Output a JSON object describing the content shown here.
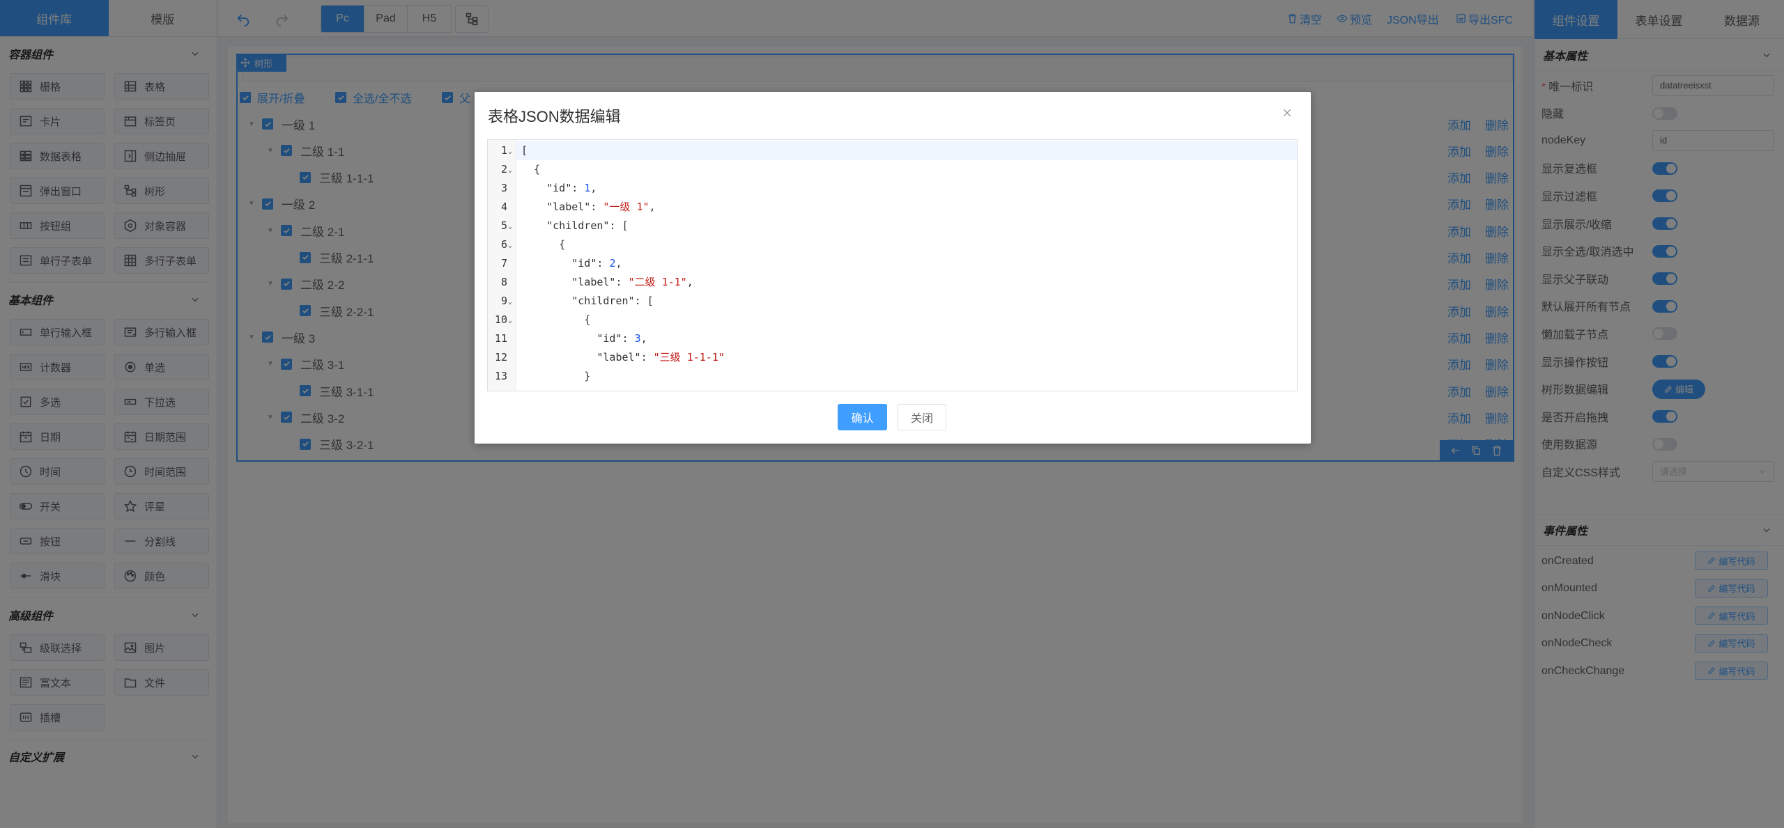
{
  "left": {
    "tabs": [
      "组件库",
      "模版"
    ],
    "sections": [
      {
        "title": "容器组件",
        "items": [
          {
            "label": "栅格",
            "icon": "grid-icon"
          },
          {
            "label": "表格",
            "icon": "table-icon"
          },
          {
            "label": "卡片",
            "icon": "card-icon"
          },
          {
            "label": "标签页",
            "icon": "tabs-icon"
          },
          {
            "label": "数据表格",
            "icon": "data-table-icon"
          },
          {
            "label": "侧边抽屉",
            "icon": "drawer-icon"
          },
          {
            "label": "弹出窗口",
            "icon": "dialog-icon"
          },
          {
            "label": "树形",
            "icon": "tree-icon"
          },
          {
            "label": "按钮组",
            "icon": "button-group-icon"
          },
          {
            "label": "对象容器",
            "icon": "object-container-icon"
          },
          {
            "label": "单行子表单",
            "icon": "sub-form-icon"
          },
          {
            "label": "多行子表单",
            "icon": "grid-sub-form-icon"
          }
        ]
      },
      {
        "title": "基本组件",
        "items": [
          {
            "label": "单行输入框",
            "icon": "input-icon"
          },
          {
            "label": "多行输入框",
            "icon": "textarea-icon"
          },
          {
            "label": "计数器",
            "icon": "number-icon"
          },
          {
            "label": "单选",
            "icon": "radio-icon"
          },
          {
            "label": "多选",
            "icon": "checkbox-icon"
          },
          {
            "label": "下拉选",
            "icon": "select-icon"
          },
          {
            "label": "日期",
            "icon": "date-icon"
          },
          {
            "label": "日期范围",
            "icon": "date-range-icon"
          },
          {
            "label": "时间",
            "icon": "time-icon"
          },
          {
            "label": "时间范围",
            "icon": "time-range-icon"
          },
          {
            "label": "开关",
            "icon": "switch-icon"
          },
          {
            "label": "评星",
            "icon": "star-icon"
          },
          {
            "label": "按钮",
            "icon": "button-icon"
          },
          {
            "label": "分割线",
            "icon": "divider-icon"
          },
          {
            "label": "滑块",
            "icon": "slider-icon"
          },
          {
            "label": "颜色",
            "icon": "palette-icon"
          }
        ]
      },
      {
        "title": "高级组件",
        "items": [
          {
            "label": "级联选择",
            "icon": "cascader-icon"
          },
          {
            "label": "图片",
            "icon": "picture-icon"
          },
          {
            "label": "富文本",
            "icon": "rich-text-icon"
          },
          {
            "label": "文件",
            "icon": "folder-icon"
          },
          {
            "label": "插槽",
            "icon": "slot-icon"
          }
        ]
      },
      {
        "title": "自定义扩展",
        "items": []
      }
    ]
  },
  "toolbar": {
    "devices": [
      "Pc",
      "Pad",
      "H5"
    ],
    "active_device": "Pc",
    "actions": [
      "清空",
      "预览",
      "JSON导出",
      "导出SFC"
    ]
  },
  "canvas": {
    "tree_tag": "树形",
    "options": [
      "展开/折叠",
      "全选/全不选",
      "父"
    ],
    "add_label": "添加",
    "delete_label": "删除",
    "nodes": [
      {
        "label": "一级 1",
        "level": 1,
        "expanded": true
      },
      {
        "label": "二级 1-1",
        "level": 2,
        "expanded": true
      },
      {
        "label": "三级 1-1-1",
        "level": 3
      },
      {
        "label": "一级 2",
        "level": 1,
        "expanded": true
      },
      {
        "label": "二级 2-1",
        "level": 2,
        "expanded": true
      },
      {
        "label": "三级 2-1-1",
        "level": 3
      },
      {
        "label": "二级 2-2",
        "level": 2,
        "expanded": true
      },
      {
        "label": "三级 2-2-1",
        "level": 3
      },
      {
        "label": "一级 3",
        "level": 1,
        "expanded": true
      },
      {
        "label": "二级 3-1",
        "level": 2,
        "expanded": true
      },
      {
        "label": "三级 3-1-1",
        "level": 3
      },
      {
        "label": "二级 3-2",
        "level": 2,
        "expanded": true
      },
      {
        "label": "三级 3-2-1",
        "level": 3
      }
    ]
  },
  "right": {
    "tabs": [
      "组件设置",
      "表单设置",
      "数据源"
    ],
    "basic_title": "基本属性",
    "props": [
      {
        "label": "唯一标识",
        "type": "input",
        "value": "datatreeisxst",
        "required": true
      },
      {
        "label": "隐藏",
        "type": "switch",
        "on": false
      },
      {
        "label": "nodeKey",
        "type": "input",
        "value": "id"
      },
      {
        "label": "显示复选框",
        "type": "switch",
        "on": true
      },
      {
        "label": "显示过滤框",
        "type": "switch",
        "on": true
      },
      {
        "label": "显示展示/收缩",
        "type": "switch",
        "on": true
      },
      {
        "label": "显示全选/取消选中",
        "type": "switch",
        "on": true
      },
      {
        "label": "显示父子联动",
        "type": "switch",
        "on": true
      },
      {
        "label": "默认展开所有节点",
        "type": "switch",
        "on": true
      },
      {
        "label": "懒加载子节点",
        "type": "switch",
        "on": false
      },
      {
        "label": "显示操作按钮",
        "type": "switch",
        "on": true
      },
      {
        "label": "树形数据编辑",
        "type": "button",
        "value": "编辑"
      },
      {
        "label": "是否开启拖拽",
        "type": "switch",
        "on": true
      },
      {
        "label": "使用数据源",
        "type": "switch",
        "on": false
      },
      {
        "label": "自定义CSS样式",
        "type": "select",
        "value": "请选择"
      }
    ],
    "event_title": "事件属性",
    "events": [
      "onCreated",
      "onMounted",
      "onNodeClick",
      "onNodeCheck",
      "onCheckChange"
    ],
    "event_button": "编写代码"
  },
  "modal": {
    "title": "表格JSON数据编辑",
    "confirm": "确认",
    "cancel": "关闭",
    "lines": [
      {
        "n": "1",
        "fold": true,
        "code": "["
      },
      {
        "n": "2",
        "fold": true,
        "code": "  {"
      },
      {
        "n": "3",
        "code": "    \"id\": 1,"
      },
      {
        "n": "4",
        "code": "    \"label\": \"一级 1\","
      },
      {
        "n": "5",
        "fold": true,
        "code": "    \"children\": ["
      },
      {
        "n": "6",
        "fold": true,
        "code": "      {"
      },
      {
        "n": "7",
        "code": "        \"id\": 2,"
      },
      {
        "n": "8",
        "code": "        \"label\": \"二级 1-1\","
      },
      {
        "n": "9",
        "fold": true,
        "code": "        \"children\": ["
      },
      {
        "n": "10",
        "fold": true,
        "code": "          {"
      },
      {
        "n": "11",
        "code": "            \"id\": 3,"
      },
      {
        "n": "12",
        "code": "            \"label\": \"三级 1-1-1\""
      },
      {
        "n": "13",
        "code": "          }"
      }
    ]
  }
}
